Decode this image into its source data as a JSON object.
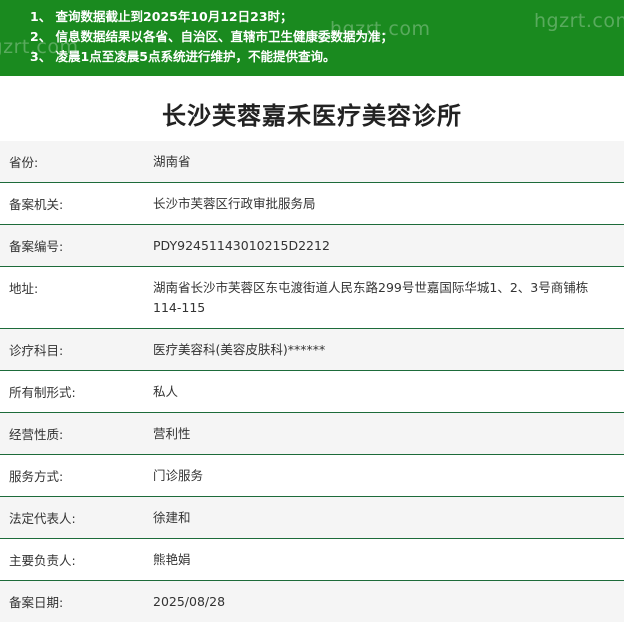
{
  "notice": {
    "lines": [
      "1、 查询数据截止到2025年10月12日23时；",
      "2、 信息数据结果以各省、自治区、直辖市卫生健康委数据为准；",
      "3、 凌晨1点至凌晨5点系统进行维护，不能提供查询。"
    ],
    "watermark": "hgzrt.com"
  },
  "title": "长沙芙蓉嘉禾医疗美容诊所",
  "rows": [
    {
      "label": "省份:",
      "value": "湖南省"
    },
    {
      "label": "备案机关:",
      "value": "长沙市芙蓉区行政审批服务局"
    },
    {
      "label": "备案编号:",
      "value": "PDY92451143010215D2212"
    },
    {
      "label": "地址:",
      "value": "湖南省长沙市芙蓉区东屯渡街道人民东路299号世嘉国际华城1、2、3号商铺栋114-115"
    },
    {
      "label": "诊疗科目:",
      "value": "医疗美容科(美容皮肤科)******"
    },
    {
      "label": "所有制形式:",
      "value": "私人"
    },
    {
      "label": "经营性质:",
      "value": "营利性"
    },
    {
      "label": "服务方式:",
      "value": "门诊服务"
    },
    {
      "label": "法定代表人:",
      "value": "徐建和"
    },
    {
      "label": "主要负责人:",
      "value": "熊艳娟"
    },
    {
      "label": "备案日期:",
      "value": "2025/08/28"
    }
  ],
  "colors": {
    "notice_bg": "#1a8a1f",
    "row_border": "#1d6b3a"
  }
}
